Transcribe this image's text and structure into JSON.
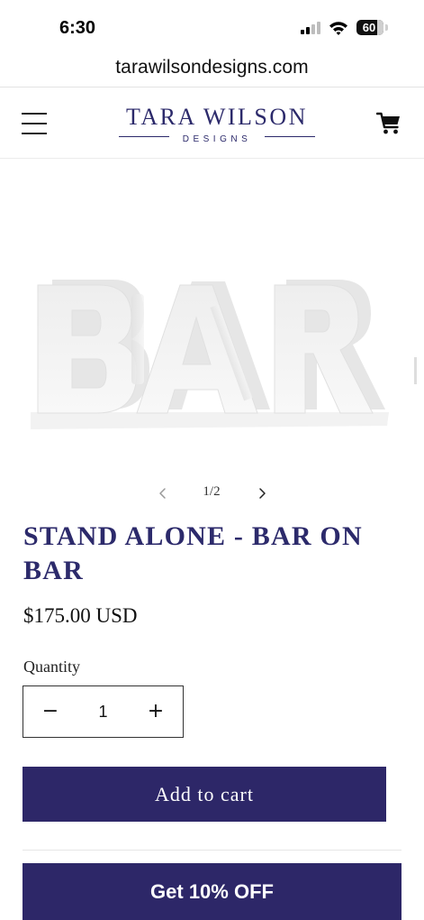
{
  "status_bar": {
    "time": "6:30",
    "battery": "60",
    "icons": [
      "signal-icon",
      "wifi-icon",
      "battery-icon"
    ]
  },
  "browser": {
    "url": "tarawilsondesigns.com"
  },
  "header": {
    "logo_main": "TARA WILSON",
    "logo_sub": "DESIGNS",
    "icons": [
      "menu-icon",
      "cart-icon"
    ],
    "brand_color": "#2c2a6b"
  },
  "product": {
    "image_text": "BAR",
    "slider": {
      "counter": "1/2",
      "icons": [
        "chevron-left-icon",
        "chevron-right-icon"
      ]
    },
    "title": "STAND ALONE - BAR ON BAR",
    "price": "$175.00 USD",
    "quantity_label": "Quantity",
    "quantity": {
      "minus": "−",
      "value": "1",
      "plus": "+"
    },
    "add_to_cart": "Add to cart",
    "button_color": "#2d2768"
  },
  "promo": {
    "label": "Get 10% OFF"
  }
}
